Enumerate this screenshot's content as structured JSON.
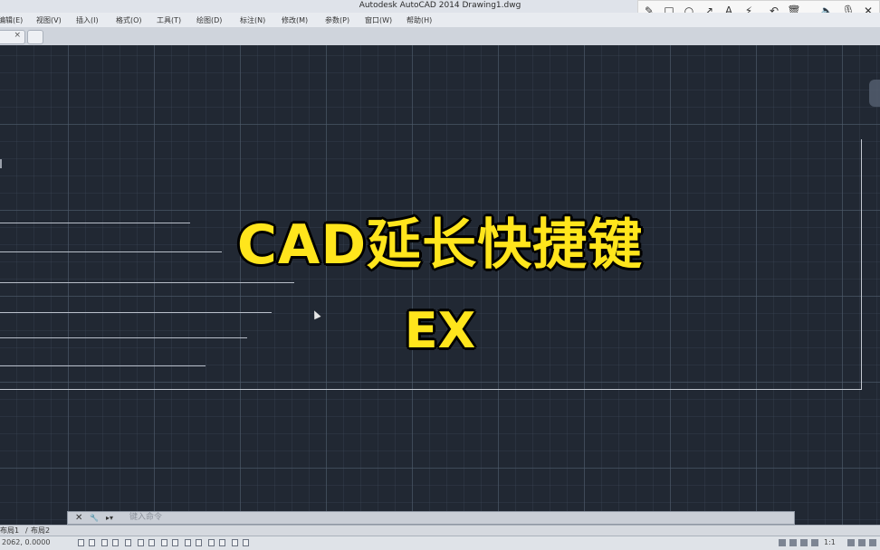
{
  "window": {
    "title": "Autodesk AutoCAD 2014    Drawing1.dwg"
  },
  "menu": {
    "items": [
      "编辑(E)",
      "视图(V)",
      "插入(I)",
      "格式(O)",
      "工具(T)",
      "绘图(D)",
      "标注(N)",
      "修改(M)",
      "参数(P)",
      "窗口(W)",
      "帮助(H)"
    ]
  },
  "annotation_toolbar": {
    "tools": [
      "pencil-icon",
      "rectangle-icon",
      "circle-icon",
      "arrow-icon",
      "text-icon",
      "highlighter-icon",
      "undo-icon",
      "trash-icon",
      "speaker-icon",
      "microphone-icon",
      "close-icon"
    ],
    "glyphs": [
      "✎",
      "□",
      "○",
      "↗",
      "A",
      "⚡",
      "↶",
      "🗑",
      "🔈",
      "🎙",
      "✕"
    ]
  },
  "overlay": {
    "title": "CAD延长快捷键",
    "subtitle": "EX",
    "text_color": "#ffe51c"
  },
  "command_line": {
    "prompt": "键入命令",
    "close_glyph": "✕",
    "wrench_glyph": "🔧"
  },
  "layout_tabs": [
    "布局1",
    "布局2"
  ],
  "status": {
    "coords": "2062, 0.0000",
    "scale": "1:1"
  }
}
